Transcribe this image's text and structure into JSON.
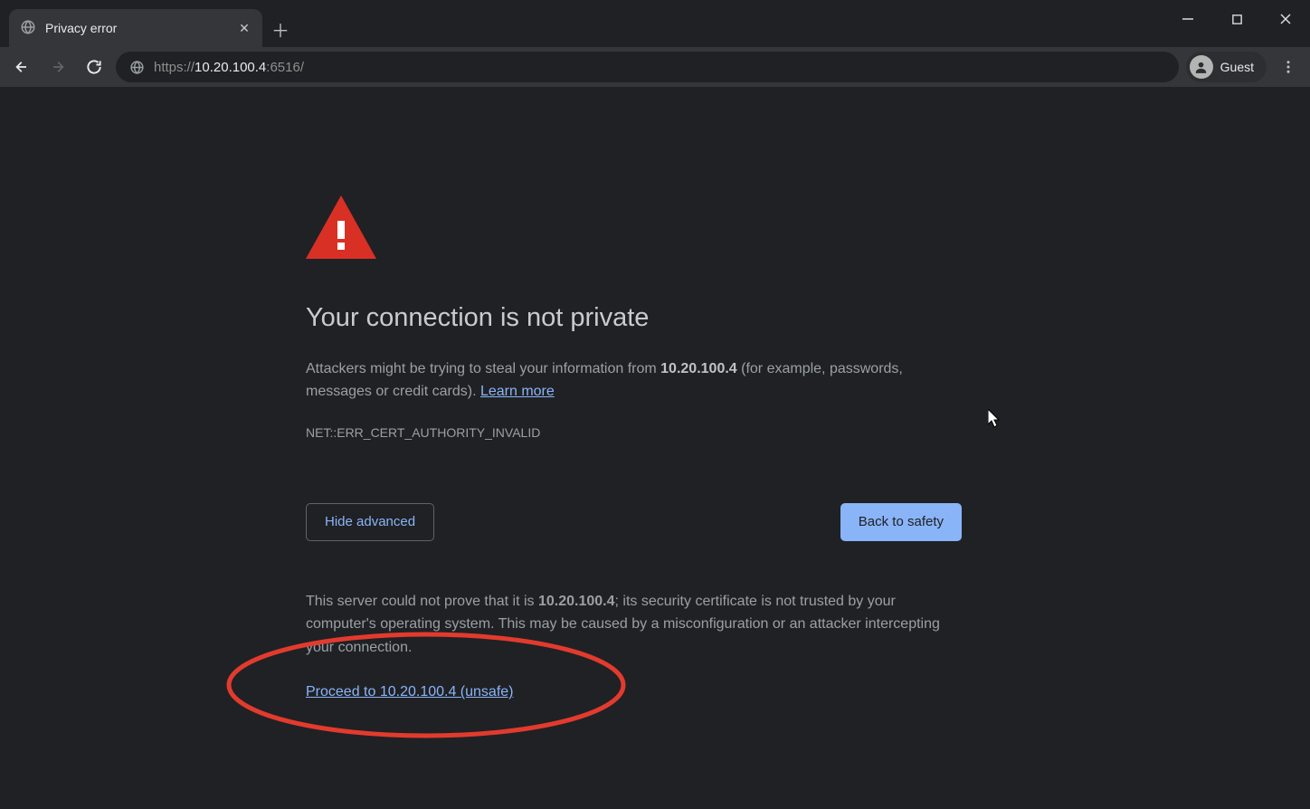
{
  "window": {
    "tab_title": "Privacy error",
    "profile_label": "Guest"
  },
  "address": {
    "scheme": "https://",
    "host": "10.20.100.4",
    "rest": ":6516/"
  },
  "content": {
    "headline": "Your connection is not private",
    "desc1": "Attackers might be trying to steal your information from ",
    "host": "10.20.100.4",
    "desc2": " (for example, passwords, messages or credit cards). ",
    "learn_more": "Learn more",
    "error_code": "NET::ERR_CERT_AUTHORITY_INVALID",
    "hide_advanced": "Hide advanced",
    "back_to_safety": "Back to safety",
    "adv1": "This server could not prove that it is ",
    "adv2": "; its security certificate is not trusted by your computer's operating system. This may be caused by a misconfiguration or an attacker intercepting your connection.",
    "proceed": "Proceed to 10.20.100.4 (unsafe)"
  }
}
